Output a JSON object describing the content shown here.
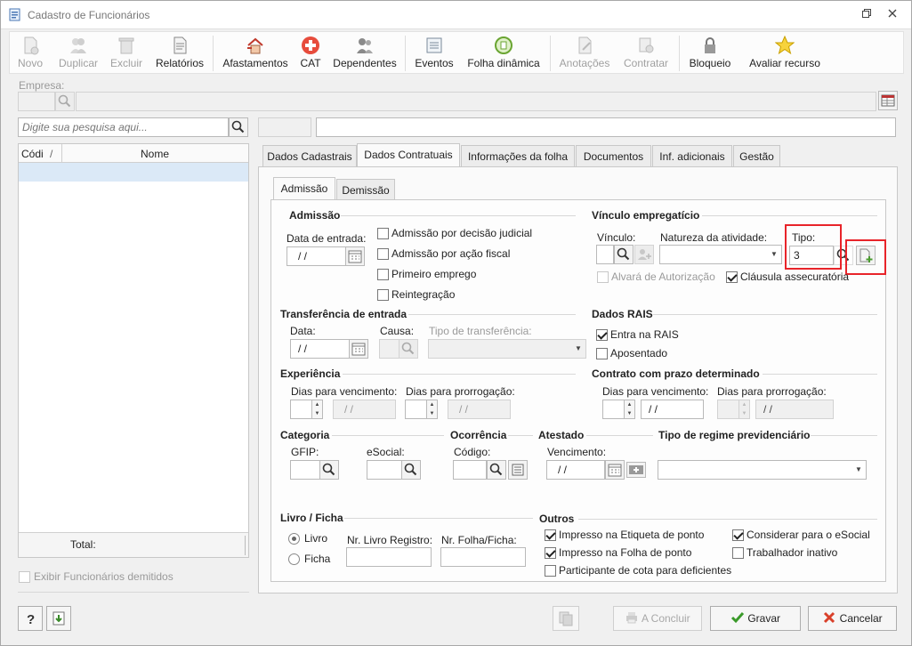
{
  "window": {
    "title": "Cadastro de Funcionários"
  },
  "toolbar": {
    "novo": "Novo",
    "duplicar": "Duplicar",
    "excluir": "Excluir",
    "relatorios": "Relatórios",
    "afastamentos": "Afastamentos",
    "cat": "CAT",
    "dependentes": "Dependentes",
    "eventos": "Eventos",
    "folha_dinamica": "Folha dinâmica",
    "anotacoes": "Anotações",
    "contratar": "Contratar",
    "bloqueio": "Bloqueio",
    "avaliar": "Avaliar recurso"
  },
  "empresa": {
    "label": "Empresa:"
  },
  "search": {
    "placeholder": "Digite sua pesquisa aqui..."
  },
  "grid": {
    "col_codigo": "Códi",
    "col_sort": "/",
    "col_nome": "Nome",
    "total_label": "Total:"
  },
  "exibir_demitidos": "Exibir Funcionários demitidos",
  "tabs": [
    "Dados Cadastrais",
    "Dados Contratuais",
    "Informações da folha",
    "Documentos",
    "Inf. adicionais",
    "Gestão"
  ],
  "subtabs": [
    "Admissão",
    "Demissão"
  ],
  "admissao": {
    "title": "Admissão",
    "data_entrada": "Data de entrada:",
    "data_value": "  /  /",
    "cb_judicial": "Admissão por decisão judicial",
    "cb_fiscal": "Admissão por ação fiscal",
    "cb_primeiro": "Primeiro emprego",
    "cb_reintegracao": "Reintegração"
  },
  "vinculo": {
    "title": "Vínculo empregatício",
    "vinculo": "Vínculo:",
    "natureza": "Natureza da atividade:",
    "tipo": "Tipo:",
    "tipo_value": "3",
    "alvara": "Alvará de Autorização",
    "clausula": "Cláusula assecuratória"
  },
  "transferencia": {
    "title": "Transferência de entrada",
    "data": "Data:",
    "data_value": " /  /",
    "causa": "Causa:",
    "tipo": "Tipo de transferência:"
  },
  "rais": {
    "title": "Dados RAIS",
    "entra": "Entra na RAIS",
    "aposentado": "Aposentado"
  },
  "experiencia": {
    "title": "Experiência",
    "dias_venc": "Dias para vencimento:",
    "dias_prorr": "Dias para prorrogação:",
    "date_a": "  /  /",
    "date_b": "  /  /"
  },
  "contrato": {
    "title": "Contrato com prazo determinado",
    "dias_venc": "Dias para vencimento:",
    "dias_prorr": "Dias para prorrogação:",
    "date_a": " /  /",
    "date_b": " /  /"
  },
  "categoria": {
    "title": "Categoria",
    "gfip": "GFIP:",
    "esocial": "eSocial:"
  },
  "ocorrencia": {
    "title": "Ocorrência",
    "codigo": "Código:"
  },
  "atestado": {
    "title": "Atestado",
    "vencimento": "Vencimento:",
    "value": "  /  /"
  },
  "regime": {
    "title": "Tipo de regime previdenciário"
  },
  "livro": {
    "title": "Livro / Ficha",
    "livro": "Livro",
    "ficha": "Ficha",
    "nr_livro": "Nr. Livro Registro:",
    "nr_folha": "Nr. Folha/Ficha:"
  },
  "outros": {
    "title": "Outros",
    "etiqueta": "Impresso na Etiqueta de ponto",
    "folha": "Impresso na Folha de ponto",
    "cota": "Participante de cota para deficientes",
    "esocial": "Considerar para o eSocial",
    "inativo": "Trabalhador inativo"
  },
  "footer": {
    "concluir": "A Concluir",
    "gravar": "Gravar",
    "cancelar": "Cancelar"
  },
  "colors": {
    "highlight": "#e8242a",
    "selected_row": "#dbe9f7"
  }
}
